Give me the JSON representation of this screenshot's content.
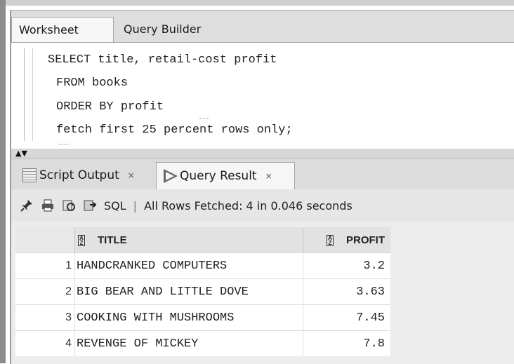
{
  "editor_tabs": {
    "worksheet": "Worksheet",
    "query_builder": "Query Builder"
  },
  "sql_lines": [
    "SELECT title, retail-cost profit",
    "FROM books",
    "ORDER BY profit",
    "fetch first 25 percent rows only;"
  ],
  "splitter": {
    "arrows": "▲▼"
  },
  "output_tabs": [
    {
      "label": "Script Output",
      "close": "×",
      "icon": "script-icon"
    },
    {
      "label": "Query Result",
      "close": "×",
      "icon": "play-icon"
    }
  ],
  "toolbar": {
    "icons": [
      "pin-icon",
      "print-icon",
      "refresh-icon",
      "export-icon"
    ],
    "sql_label": "SQL",
    "separator": "|",
    "status": "All Rows Fetched: 4 in 0.046 seconds"
  },
  "grid": {
    "columns": [
      "TITLE",
      "PROFIT"
    ],
    "rows": [
      {
        "num": "1",
        "title": "HANDCRANKED COMPUTERS",
        "profit": "3.2"
      },
      {
        "num": "2",
        "title": "BIG BEAR AND LITTLE DOVE",
        "profit": "3.63"
      },
      {
        "num": "3",
        "title": "COOKING WITH MUSHROOMS",
        "profit": "7.45"
      },
      {
        "num": "4",
        "title": "REVENGE OF MICKEY",
        "profit": "7.8"
      }
    ]
  }
}
